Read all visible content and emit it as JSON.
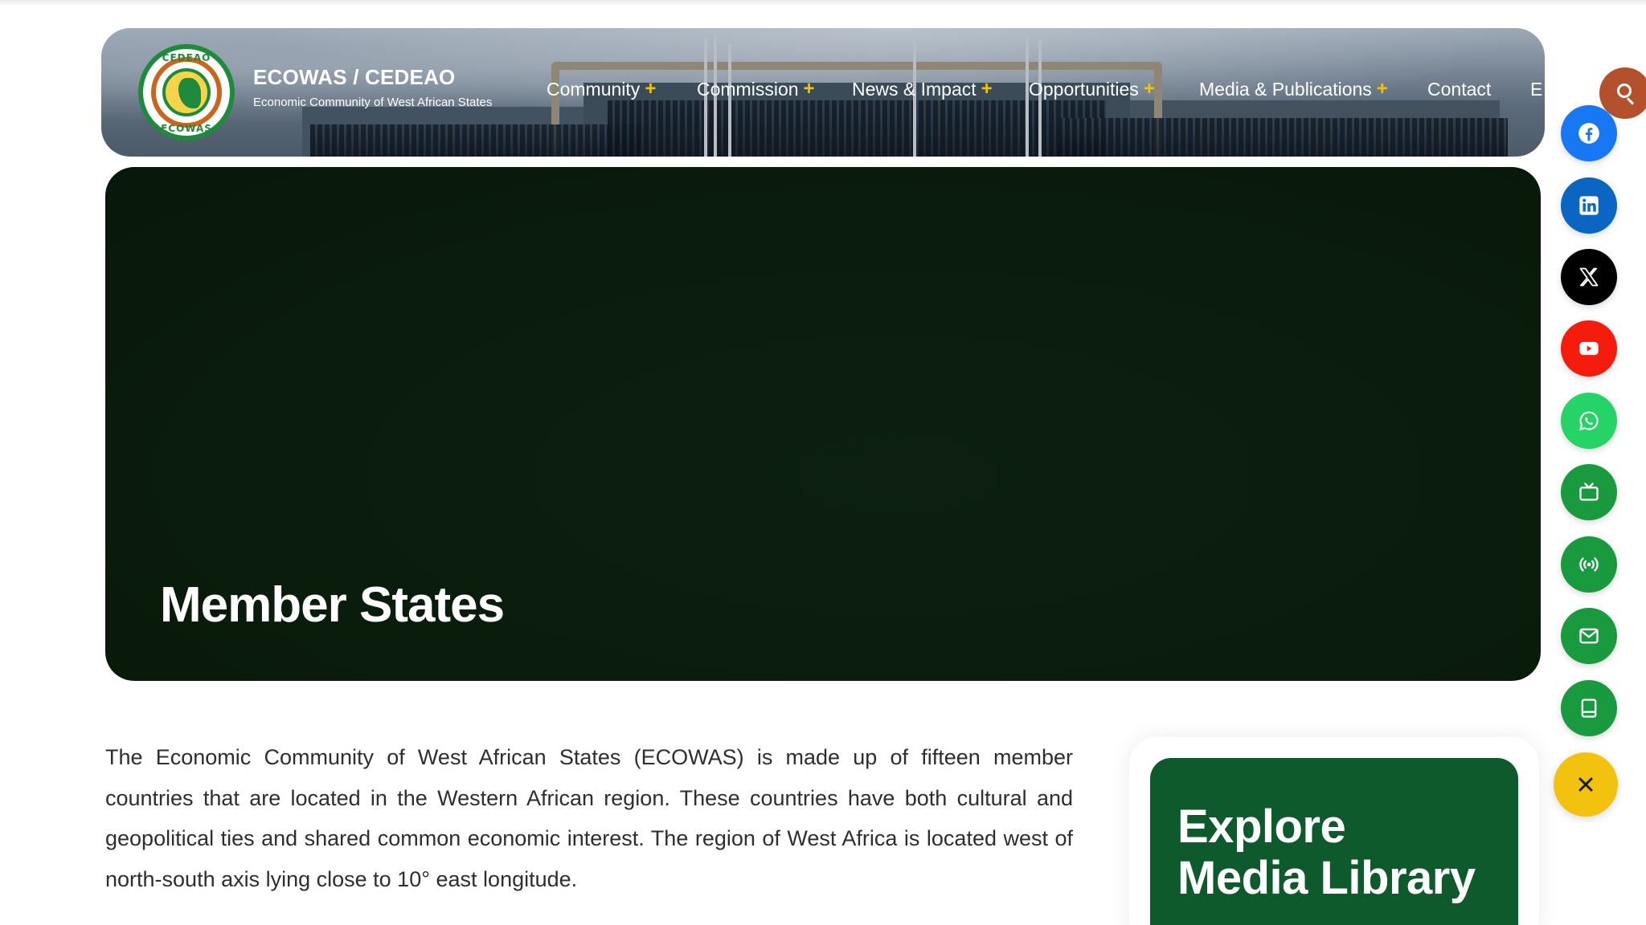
{
  "brand": {
    "title": "ECOWAS / CEDEAO",
    "subtitle": "Economic Community of West African States",
    "logo_top_text": "CEDEAO",
    "logo_bottom_text": "ECOWAS"
  },
  "nav": {
    "items": [
      {
        "label": "Community",
        "has_submenu": true
      },
      {
        "label": "Commission",
        "has_submenu": true
      },
      {
        "label": "News & Impact",
        "has_submenu": true
      },
      {
        "label": "Opportunities",
        "has_submenu": true
      },
      {
        "label": "Media & Publications",
        "has_submenu": true
      },
      {
        "label": "Contact",
        "has_submenu": false
      },
      {
        "label": "E",
        "has_submenu": false
      }
    ],
    "submenu_marker": "+"
  },
  "hero": {
    "title": "Member States"
  },
  "intro": {
    "text": "The Economic Community of West African States (ECOWAS) is made up of fifteen member countries that are located in the Western African region. These countries have both cultural and geopolitical ties and shared common economic interest. The region of West Africa is located west of north-south axis lying close to 10° east longitude."
  },
  "media_card": {
    "title_line1": "Explore",
    "title_line2": "Media Library"
  },
  "social_bar": [
    {
      "name": "facebook",
      "icon": "facebook-icon",
      "color": "#1877f2"
    },
    {
      "name": "linkedin",
      "icon": "linkedin-icon",
      "color": "#0a66c2"
    },
    {
      "name": "x",
      "icon": "x-icon",
      "color": "#000000"
    },
    {
      "name": "youtube",
      "icon": "youtube-icon",
      "color": "#f61c0d"
    },
    {
      "name": "whatsapp",
      "icon": "whatsapp-icon",
      "color": "#25d366"
    },
    {
      "name": "tv",
      "icon": "tv-icon",
      "color": "#1a9a3f"
    },
    {
      "name": "radio",
      "icon": "broadcast-icon",
      "color": "#1a9a3f"
    },
    {
      "name": "mail",
      "icon": "mail-icon",
      "color": "#1a9a3f"
    },
    {
      "name": "book",
      "icon": "book-icon",
      "color": "#1a9a3f"
    }
  ],
  "colors": {
    "accent_yellow": "#f2c20f",
    "ecowas_green": "#0e5a2c",
    "hero_dark": "#0a1c0c",
    "search_button": "#b2512b"
  }
}
